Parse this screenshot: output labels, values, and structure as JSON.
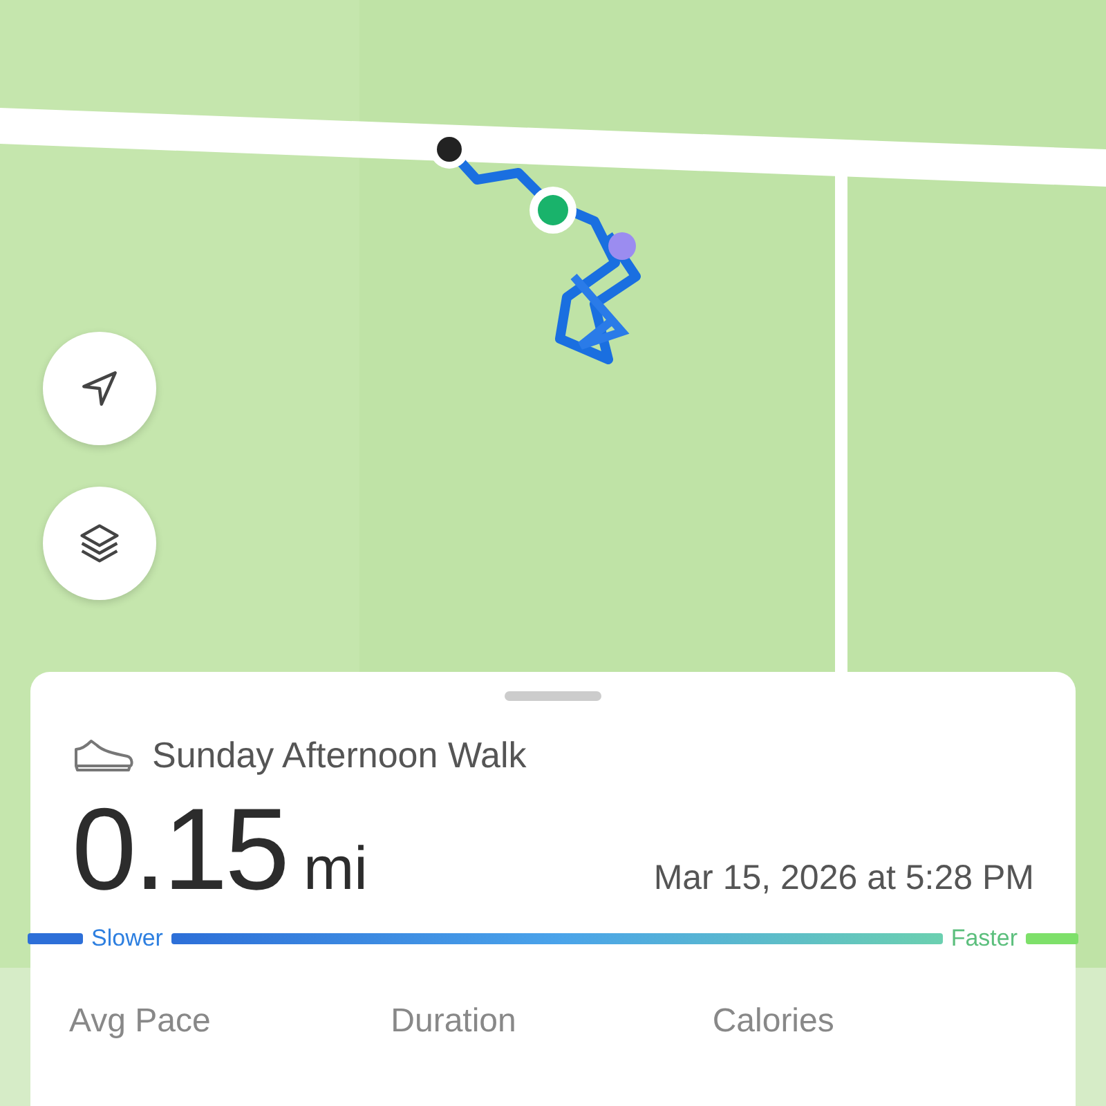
{
  "map_controls": [
    {
      "kind": "locate"
    },
    {
      "kind": "layers"
    }
  ],
  "activity": {
    "title": "Sunday Afternoon Walk",
    "distance": "0.15",
    "unit": "mi",
    "date": "Mar 15, 2026 at 5:28 PM",
    "scale": {
      "slower": "Slower",
      "faster": "Faster"
    }
  },
  "stats": [
    {
      "label": "Avg Pace"
    },
    {
      "label": "Duration"
    },
    {
      "label": "Calories"
    }
  ]
}
